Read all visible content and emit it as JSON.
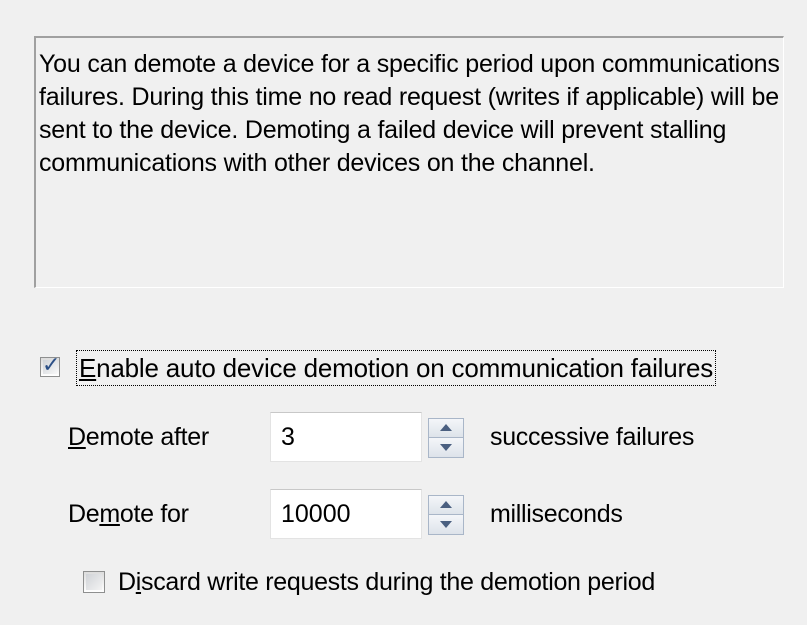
{
  "description": {
    "text": "You can demote a device for a specific period upon communications failures. During this time no read request (writes if applicable) will be sent to the device. Demoting a failed device will prevent stalling communications with other devices on the channel."
  },
  "enable_demotion": {
    "checked": true,
    "label_prefix": "",
    "label_underlined": "E",
    "label_rest": "nable auto device demotion on communication failures"
  },
  "demote_after": {
    "label_underlined": "D",
    "label_rest": "emote after",
    "value": "3",
    "suffix": "successive failures"
  },
  "demote_for": {
    "label_prefix": "De",
    "label_underlined": "m",
    "label_rest": "ote for",
    "value": "10000",
    "suffix": "milliseconds"
  },
  "discard_writes": {
    "checked": false,
    "label_prefix": "D",
    "label_underlined": "i",
    "label_rest": "scard write requests during the demotion period"
  },
  "colors": {
    "background": "#f0f0f0",
    "check_mark": "#2b4f86",
    "spin_border": "#a9b6c8"
  }
}
